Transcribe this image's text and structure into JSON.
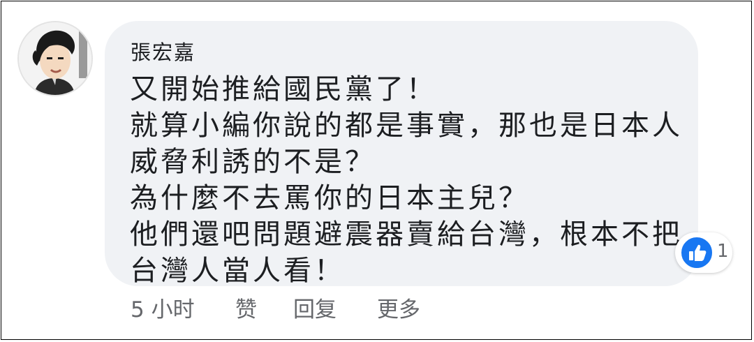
{
  "comment": {
    "author": "張宏嘉",
    "lines": [
      "又開始推給國民黨了！",
      "就算小編你說的都是事實，那也是日本人",
      "威脅利誘的不是？",
      "為什麼不去罵你的日本主兒？",
      "他們還吧問題避震器賣給台灣，根本不把",
      "台灣人當人看！"
    ],
    "reaction": {
      "icon": "like-icon",
      "count": "1",
      "color": "#1877f2"
    }
  },
  "actions": {
    "timestamp": "5 小时",
    "like": "赞",
    "reply": "回复",
    "more": "更多"
  },
  "colors": {
    "bubble": "#f0f2f5",
    "text": "#1c1e21",
    "meta": "#65676b"
  }
}
